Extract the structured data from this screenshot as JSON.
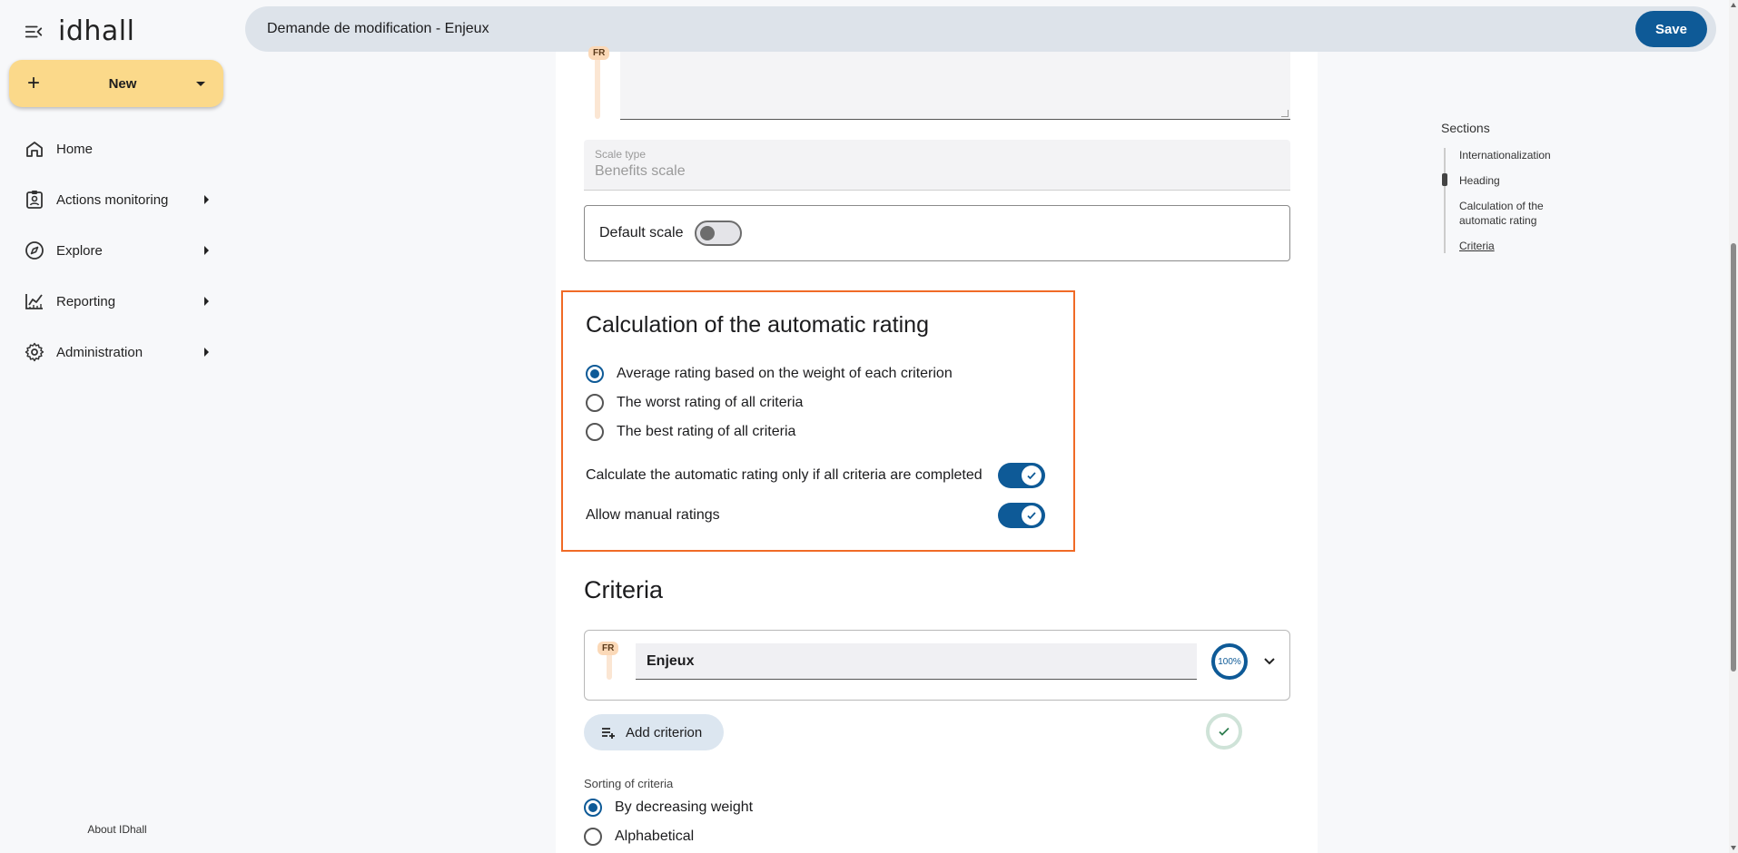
{
  "sidebar": {
    "logo": "idhall",
    "new_label": "New",
    "items": [
      {
        "label": "Home"
      },
      {
        "label": "Actions monitoring"
      },
      {
        "label": "Explore"
      },
      {
        "label": "Reporting"
      },
      {
        "label": "Administration"
      }
    ],
    "about": "About IDhall"
  },
  "topbar": {
    "title": "Demande de modification - Enjeux",
    "save_label": "Save"
  },
  "form": {
    "lang_badge": "FR",
    "scale_type_label": "Scale type",
    "scale_type_value": "Benefits scale",
    "default_scale_label": "Default scale"
  },
  "calc": {
    "title": "Calculation of the automatic rating",
    "options": [
      {
        "label": "Average rating based on the weight of each criterion",
        "selected": true
      },
      {
        "label": "The worst rating of all criteria",
        "selected": false
      },
      {
        "label": "The best rating of all criteria",
        "selected": false
      }
    ],
    "only_if_completed_label": "Calculate the automatic rating only if all criteria are completed",
    "allow_manual_label": "Allow manual ratings"
  },
  "criteria": {
    "title": "Criteria",
    "lang_badge": "FR",
    "name_value": "Enjeux",
    "percent": "100%",
    "add_label": "Add criterion",
    "sort_label": "Sorting of criteria",
    "sort_options": [
      {
        "label": "By decreasing weight",
        "selected": true
      },
      {
        "label": "Alphabetical",
        "selected": false
      }
    ]
  },
  "sections": {
    "heading": "Sections",
    "items": [
      {
        "label": "Internationalization"
      },
      {
        "label": "Heading"
      },
      {
        "label": "Calculation of the automatic rating"
      },
      {
        "label": "Criteria"
      }
    ]
  },
  "colors": {
    "accent": "#0e5a97",
    "new_button": "#fbd98a",
    "highlight_border": "#f06a26"
  }
}
